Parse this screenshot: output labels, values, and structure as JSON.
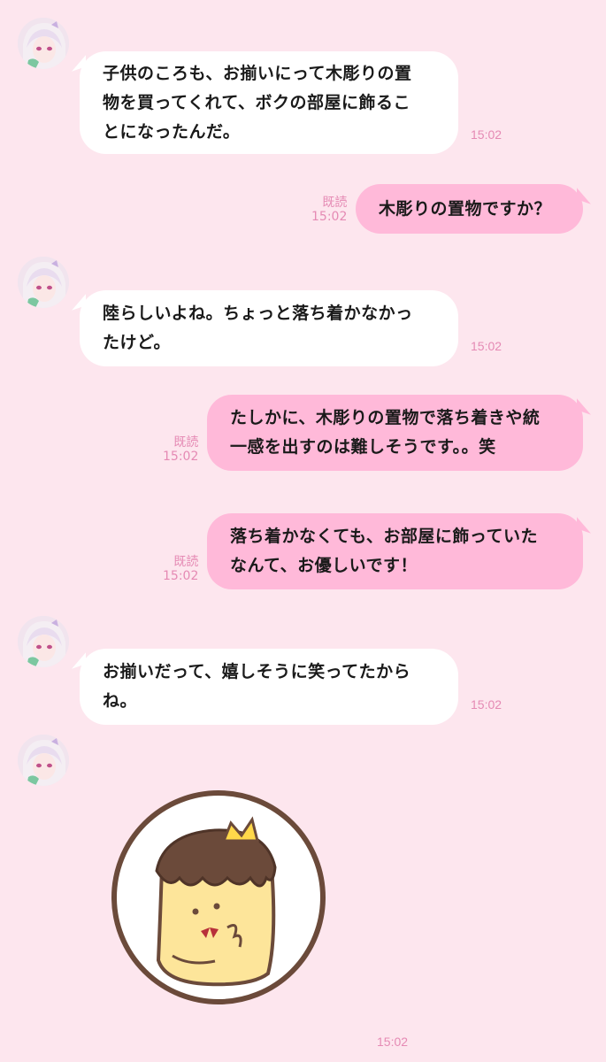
{
  "messages": [
    {
      "lines": [
        "子供のころも、お揃いにって木彫りの置",
        "物を買ってくれて、ボクの部屋に飾るこ",
        "とになったんだ。"
      ],
      "time": "15:02"
    },
    {
      "lines": [
        "木彫りの置物ですか？"
      ],
      "read": "既読",
      "time": "15:02"
    },
    {
      "lines": [
        "陸らしいよね。ちょっと落ち着かなかっ",
        "たけど。"
      ],
      "time": "15:02"
    },
    {
      "lines": [
        "たしかに、木彫りの置物で落ち着きや統",
        "一感を出すのは難しそうです。。笑"
      ],
      "read": "既読",
      "time": "15:02"
    },
    {
      "lines": [
        "落ち着かなくても、お部屋に飾っていた",
        "なんて、お優しいです！"
      ],
      "read": "既読",
      "time": "15:02"
    },
    {
      "lines": [
        "お揃いだって、嬉しそうに笑ってたから",
        "ね。"
      ],
      "time": "15:02"
    },
    {
      "time": "15:02"
    }
  ],
  "colors": {
    "background": "#fde6ee",
    "incoming": "#ffffff",
    "outgoing": "#ffb9d9",
    "meta": "#e58ab4"
  },
  "icons": {
    "avatar": "avatar-icon",
    "sticker": "pudding-crown-sticker"
  }
}
